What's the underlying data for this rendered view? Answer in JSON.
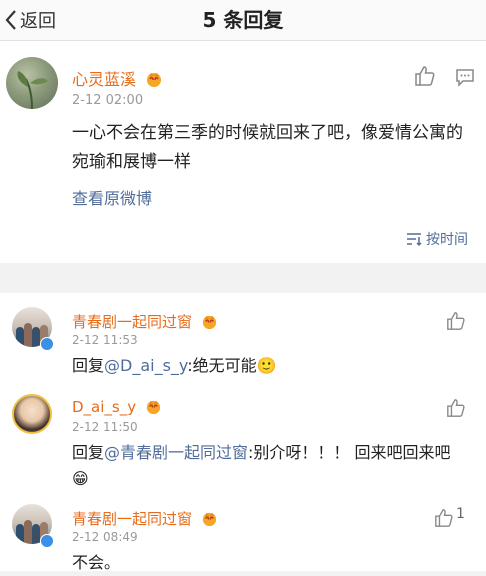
{
  "header": {
    "back_label": "返回",
    "title": "5 条回复"
  },
  "main_post": {
    "user": "心灵蓝溪",
    "time": "2-12 02:00",
    "text": "一心不会在第三季的时候就回来了吧，像爱情公寓的宛瑜和展博一样",
    "view_original": "查看原微博",
    "sort_label": "按时间"
  },
  "replies": [
    {
      "user": "青春剧一起同过窗",
      "time": "2-12 11:53",
      "prefix": "回复",
      "mention": "@D_ai_s_y",
      "text": ":绝无可能",
      "emoji": "🙂",
      "likes": ""
    },
    {
      "user": "D_ai_s_y",
      "time": "2-12 11:50",
      "prefix": "回复",
      "mention": "@青春剧一起同过窗",
      "text": ":别介呀！！！ 回来吧回来吧",
      "emoji": "😁",
      "likes": ""
    },
    {
      "user": "青春剧一起同过窗",
      "time": "2-12 08:49",
      "text": "不会。",
      "likes": "1"
    }
  ],
  "colors": {
    "name": "#e86b1a",
    "link": "#506d9a",
    "verified": "#3b8fe6"
  }
}
